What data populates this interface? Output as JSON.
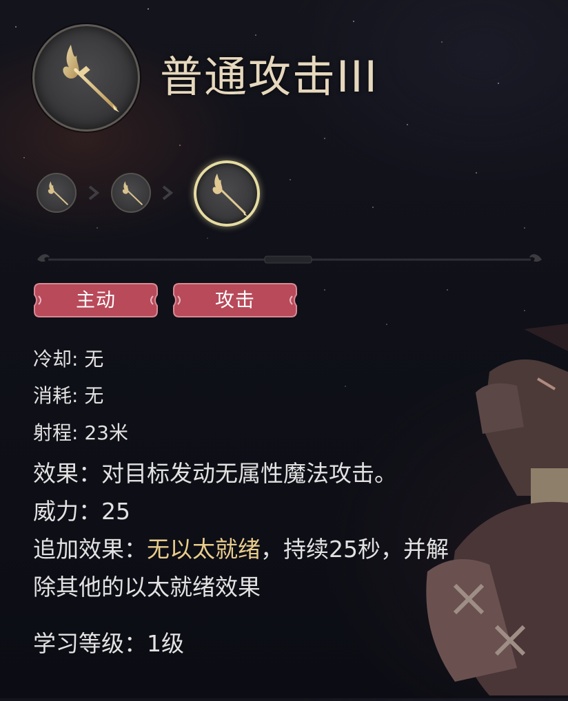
{
  "skill": {
    "name": "普通攻击III",
    "icon": "staff-icon",
    "upgrade_path": [
      "staff-icon",
      "staff-icon",
      "staff-icon"
    ],
    "tags": [
      "主动",
      "攻击"
    ]
  },
  "stats": {
    "cooldown": "冷却: 无",
    "cost": "消耗: 无",
    "range": "射程: 23米",
    "effect": "效果：对目标发动无属性魔法攻击。",
    "potency": "威力：25",
    "additional_effect": {
      "prefix": "追加效果：",
      "highlight": "无以太就绪",
      "suffix": "，持续25秒，并解",
      "continuation": "除其他的以太就绪效果"
    },
    "learn_level": "学习等级：1级"
  },
  "colors": {
    "title": "#e6d8bd",
    "highlight": "#e9cd8c",
    "tag_fill": "#b84a5a",
    "current_ring": "#e6dca2"
  }
}
